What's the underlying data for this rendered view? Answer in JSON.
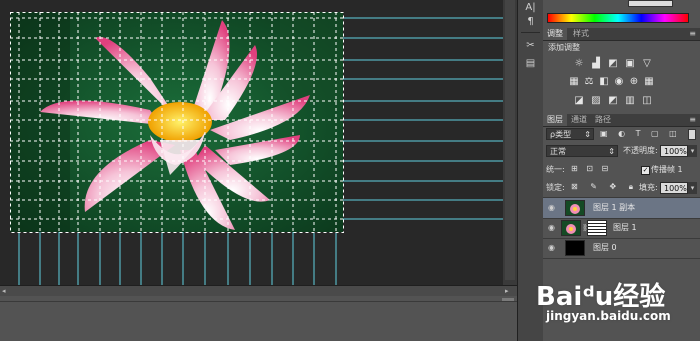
{
  "toolstrip": {
    "icons": [
      "character-icon",
      "paragraph-icon",
      "tools-icon",
      "brush-presets-icon"
    ],
    "glyphs": [
      "A|",
      "¶",
      "✂",
      "▤"
    ]
  },
  "color_panel": {
    "spectrum_colors": [
      "#ff0000",
      "#ffff00",
      "#00ff00",
      "#00ffff",
      "#0000ff",
      "#ff00ff",
      "#ff0000"
    ]
  },
  "adjustments_panel": {
    "tabs": [
      "调整",
      "样式"
    ],
    "heading": "添加调整",
    "row1_icons": [
      "brightness-icon",
      "levels-icon",
      "curves-icon",
      "exposure-icon",
      "vibrance-triangle-icon"
    ],
    "row1_glyphs": [
      "☼",
      "▟",
      "◩",
      "▣",
      "▽"
    ],
    "row2_icons": [
      "hue-saturation-icon",
      "color-balance-icon",
      "black-white-icon",
      "photo-filter-icon",
      "channel-mixer-icon",
      "color-lookup-icon"
    ],
    "row2_glyphs": [
      "▦",
      "⚖",
      "◧",
      "◉",
      "⊕",
      "▦"
    ],
    "row3_icons": [
      "invert-icon",
      "posterize-icon",
      "threshold-icon",
      "gradient-map-icon",
      "selective-color-icon"
    ],
    "row3_glyphs": [
      "◪",
      "▨",
      "◩",
      "▥",
      "◫"
    ]
  },
  "layers_panel": {
    "tabs": [
      "图层",
      "通道",
      "路径"
    ],
    "filter_kind": "ρ类型",
    "blend_mode": "正常",
    "opacity_label": "不透明度:",
    "opacity_value": "100%",
    "unify_label": "统一:",
    "propagate_label": "传播帧 1",
    "lock_label": "锁定:",
    "fill_label": "填充:",
    "fill_value": "100%",
    "layers": [
      {
        "name": "图层 1 副本",
        "selected": true
      },
      {
        "name": "图层 1",
        "selected": false
      },
      {
        "name": "图层 0",
        "selected": false
      }
    ]
  },
  "watermark": {
    "line1": "Baiᵈu经验",
    "line2": "jingyan.baidu.com"
  },
  "colors": {
    "guide": "#5fd0e0",
    "panel": "#535353",
    "selected_layer": "#6b7585"
  }
}
